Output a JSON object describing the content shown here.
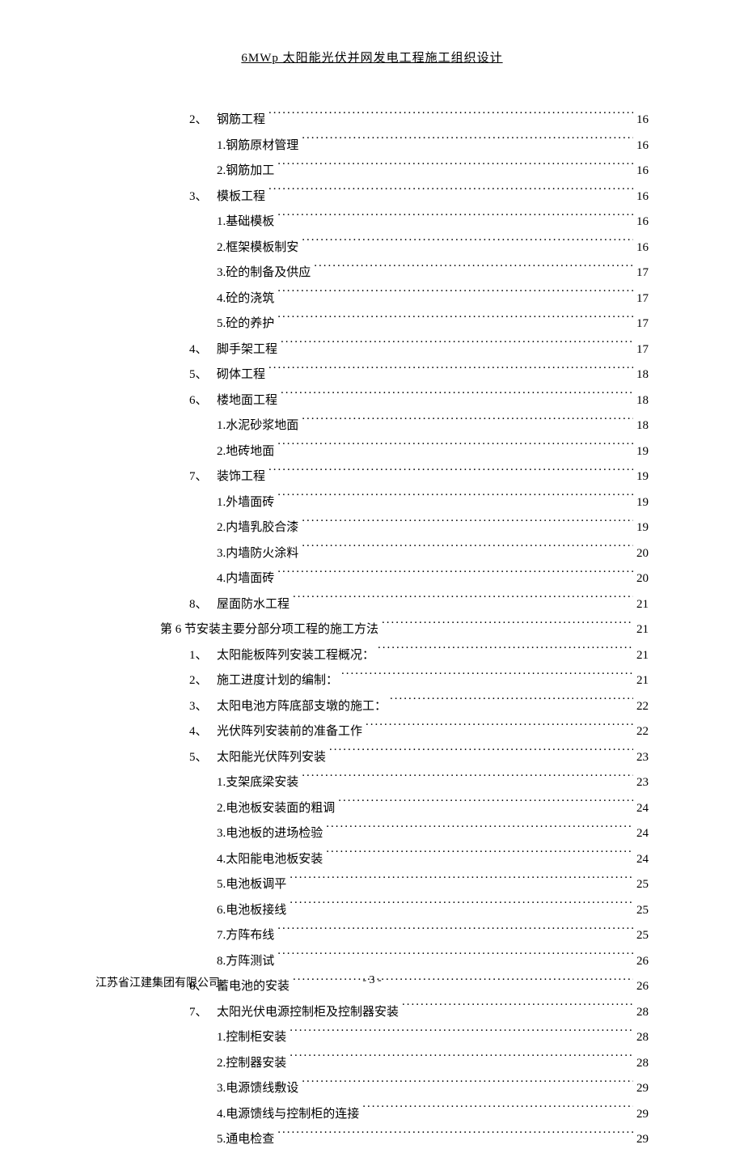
{
  "header": "6MWp 太阳能光伏并网发电工程施工组织设计",
  "toc": [
    {
      "level": 2,
      "num": "2、",
      "label": "钢筋工程",
      "page": "16"
    },
    {
      "level": 3,
      "num": "1. ",
      "label": "钢筋原材管理",
      "page": "16"
    },
    {
      "level": 3,
      "num": "2. ",
      "label": "钢筋加工",
      "page": "16"
    },
    {
      "level": 2,
      "num": "3、",
      "label": "模板工程",
      "page": "16"
    },
    {
      "level": 3,
      "num": "1. ",
      "label": "基础模板",
      "page": "16"
    },
    {
      "level": 3,
      "num": "2. ",
      "label": "框架模板制安",
      "page": "16"
    },
    {
      "level": 3,
      "num": "3. ",
      "label": "砼的制备及供应",
      "page": "17"
    },
    {
      "level": 3,
      "num": "4. ",
      "label": "砼的浇筑",
      "page": "17"
    },
    {
      "level": 3,
      "num": "5. ",
      "label": "砼的养护",
      "page": "17"
    },
    {
      "level": 2,
      "num": "4、",
      "label": "脚手架工程",
      "page": "17"
    },
    {
      "level": 2,
      "num": "5、",
      "label": "砌体工程",
      "page": "18"
    },
    {
      "level": 2,
      "num": "6、",
      "label": "楼地面工程",
      "page": "18"
    },
    {
      "level": 3,
      "num": "1. ",
      "label": "水泥砂浆地面",
      "page": "18"
    },
    {
      "level": 3,
      "num": "2. ",
      "label": "地砖地面",
      "page": "19"
    },
    {
      "level": 2,
      "num": "7、",
      "label": "装饰工程",
      "page": "19"
    },
    {
      "level": 3,
      "num": "1. ",
      "label": "外墙面砖",
      "page": "19"
    },
    {
      "level": 3,
      "num": "2. ",
      "label": "内墙乳胶合漆",
      "page": "19"
    },
    {
      "level": 3,
      "num": "3. ",
      "label": "内墙防火涂料",
      "page": "20"
    },
    {
      "level": 3,
      "num": "4. ",
      "label": "内墙面砖",
      "page": "20"
    },
    {
      "level": 2,
      "num": "8、",
      "label": "屋面防水工程",
      "page": "21"
    },
    {
      "level": 1,
      "num": "第 6 节  ",
      "label": "安装主要分部分项工程的施工方法",
      "page": "21"
    },
    {
      "level": 2,
      "num": "1、",
      "label": "太阳能板阵列安装工程概况：",
      "page": "21"
    },
    {
      "level": 2,
      "num": "2、",
      "label": "施工进度计划的编制：",
      "page": "21"
    },
    {
      "level": 2,
      "num": "3、",
      "label": "太阳电池方阵底部支墩的施工：",
      "page": "22"
    },
    {
      "level": 2,
      "num": "4、",
      "label": "光伏阵列安装前的准备工作",
      "page": "22"
    },
    {
      "level": 2,
      "num": "5、",
      "label": "太阳能光伏阵列安装",
      "page": "23"
    },
    {
      "level": 3,
      "num": "1. ",
      "label": "支架底梁安装",
      "page": "23"
    },
    {
      "level": 3,
      "num": "2. ",
      "label": "电池板安装面的粗调",
      "page": "24"
    },
    {
      "level": 3,
      "num": "3. ",
      "label": "电池板的进场检验",
      "page": "24"
    },
    {
      "level": 3,
      "num": "4. ",
      "label": "太阳能电池板安装",
      "page": "24"
    },
    {
      "level": 3,
      "num": "5. ",
      "label": "电池板调平",
      "page": "25"
    },
    {
      "level": 3,
      "num": "6. ",
      "label": "电池板接线",
      "page": "25"
    },
    {
      "level": 3,
      "num": "7. ",
      "label": "方阵布线",
      "page": "25"
    },
    {
      "level": 3,
      "num": "8. ",
      "label": "方阵测试",
      "page": "26"
    },
    {
      "level": 2,
      "num": "6、",
      "label": "蓄电池的安装",
      "page": "26"
    },
    {
      "level": 2,
      "num": "7、",
      "label": "太阳光伏电源控制柜及控制器安装",
      "page": "28"
    },
    {
      "level": 3,
      "num": "1. ",
      "label": "控制柜安装",
      "page": "28"
    },
    {
      "level": 3,
      "num": "2. ",
      "label": "控制器安装",
      "page": "28"
    },
    {
      "level": 3,
      "num": "3. ",
      "label": "电源馈线敷设",
      "page": "29"
    },
    {
      "level": 3,
      "num": "4. ",
      "label": "电源馈线与控制柜的连接",
      "page": "29"
    },
    {
      "level": 3,
      "num": "5. ",
      "label": "通电检查",
      "page": "29"
    }
  ],
  "footer": {
    "company": "江苏省江建集团有限公司",
    "page_number": "- 3 -"
  }
}
